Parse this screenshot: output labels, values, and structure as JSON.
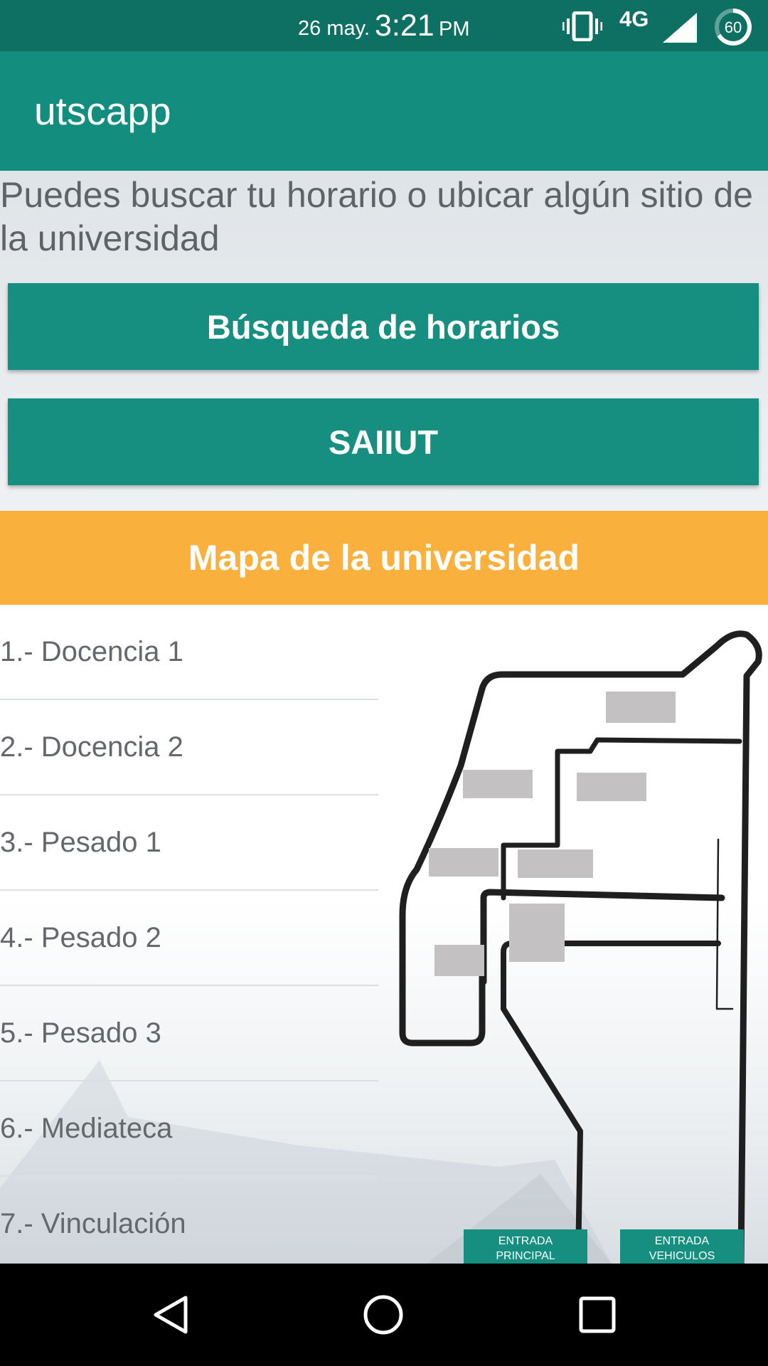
{
  "status_bar": {
    "date": "26 may.",
    "time": "3:21",
    "ampm": "PM",
    "network": "4G",
    "battery": "60"
  },
  "app_bar": {
    "title": "utscapp"
  },
  "main": {
    "intro_text": "Puedes buscar tu horario o ubicar algún sitio de la universidad",
    "schedule_button": "Búsqueda de horarios",
    "saiiut_button": "SAIIUT",
    "map_header": "Mapa de la universidad",
    "places": [
      "1.- Docencia 1",
      "2.- Docencia 2",
      "3.- Pesado 1",
      "4.- Pesado 2",
      "5.- Pesado 3",
      "6.- Mediateca",
      "7.- Vinculación"
    ],
    "map_labels": {
      "entrance_main_line1": "ENTRADA",
      "entrance_main_line2": "PRINCIPAL",
      "entrance_vehicles_line1": "ENTRADA",
      "entrance_vehicles_line2": "VEHICULOS"
    }
  },
  "colors": {
    "status_bar": "#0e6f63",
    "app_bar": "#138e7e",
    "button": "#178f80",
    "map_header": "#f9b03c",
    "building": "#c3c1c2"
  },
  "icons": {
    "status": [
      "vibrate-icon",
      "signal-icon",
      "battery-icon"
    ],
    "navigation": [
      "back-icon",
      "home-icon",
      "recent-apps-icon"
    ]
  }
}
